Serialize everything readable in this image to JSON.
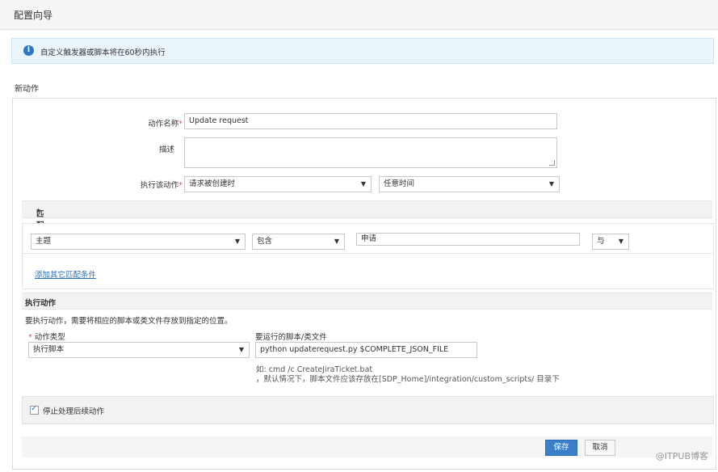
{
  "title": "配置向导",
  "info": {
    "text": "自定义触发器或脚本将在60秒内执行"
  },
  "section_new_action": "新动作",
  "form": {
    "action_name_label": "动作名称",
    "required_mark": "*",
    "action_name_value": "Update request",
    "description_label": "描述",
    "description_value": "",
    "execute_label": "执行该动作",
    "execute_when_value": "请求被创建时",
    "execute_time_value": "任意时间"
  },
  "conditions": {
    "header": "匹配如下条件",
    "field_value": "主题",
    "operator_value": "包含",
    "match_value": "申请",
    "join_value": "与",
    "add_link": "添加其它匹配条件"
  },
  "execute_action": {
    "header": "执行动作",
    "instruction": "要执行动作，需要将相应的脚本或类文件存放到指定的位置。",
    "type_label": "动作类型",
    "type_value": "执行脚本",
    "script_label": "要运行的脚本/类文件",
    "script_value": "python updaterequest.py $COMPLETE_JSON_FILE",
    "hint_example": "如: cmd /c CreateJiraTicket.bat",
    "hint_default": "，默认情况下，脚本文件应该存放在[SDP_Home]/integration/custom_scripts/ 目录下"
  },
  "stop_processing": {
    "label": "停止处理后续动作",
    "checked": true
  },
  "buttons": {
    "save": "保存",
    "cancel": "取消"
  },
  "watermark": "@ITPUB博客",
  "icons": {
    "info": "info-icon",
    "dropdown": "chevron-down-icon",
    "checkbox": "checkmark-icon"
  },
  "colors": {
    "accent": "#3b7fc8",
    "required": "#d9534f",
    "info_bg": "#eaf5fb",
    "link": "#2f6fb5"
  }
}
